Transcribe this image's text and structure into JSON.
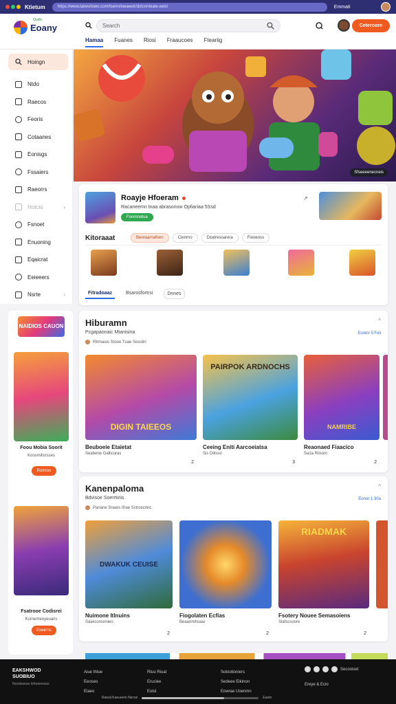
{
  "topbar": {
    "title": "Ktietum",
    "url": "https://www.taiwsrtowo.com/tsenn/ioeaeetr/dstcnnteate.eelsl",
    "user": "Emmati",
    "logo_colors": [
      "#e74c3c",
      "#2ecc71",
      "#f1c40f"
    ]
  },
  "header": {
    "brand": "Eoany",
    "brand_sub": "Quids",
    "search_placeholder": "Search",
    "cta": "Ceteroorn",
    "tabs": [
      "Hamaa",
      "Fuanes",
      "Riosi",
      "Fraaucoes",
      "Fteariig"
    ]
  },
  "sidebar": {
    "home": "Hoingn",
    "items": [
      {
        "label": "Ntdo",
        "icon": "note-icon"
      },
      {
        "label": "Raecos",
        "icon": "bookmark-icon"
      },
      {
        "label": "Feoris",
        "icon": "flag-icon"
      },
      {
        "label": "Cotaanes",
        "icon": "grid-icon"
      },
      {
        "label": "Eonisgs",
        "icon": "puzzle-icon"
      },
      {
        "label": "Fssaiers",
        "icon": "trophy-icon"
      },
      {
        "label": "Raeorrs",
        "icon": "search-icon"
      },
      {
        "label": "Hotcio",
        "icon": "clock-icon",
        "muted": true,
        "chevron": true
      },
      {
        "label": "Fsnoet",
        "icon": "doc-icon"
      },
      {
        "label": "Enuoning",
        "icon": "gamepad-icon"
      },
      {
        "label": "Eqaicrat",
        "icon": "chat-icon"
      },
      {
        "label": "Eeieeers",
        "icon": "star-icon"
      },
      {
        "label": "Nsrte",
        "icon": "pin-icon",
        "chevron": true
      }
    ]
  },
  "hero": {
    "badge": "Sfseeeenecneis"
  },
  "feature": {
    "title": "Roayje Hfoeram",
    "desc": "Racaneemn tnaa abrasoriow Opfiariaa 5Ssd",
    "tag": "Fooronatua",
    "sub_title": "Kitoraaat",
    "chips": [
      "Beoraarnafoen",
      "Cienrno",
      "Dzatresoarera",
      "Fiooeoss"
    ],
    "tabs": [
      "Fitradoaaz",
      "Bsarosfortrsi",
      "Dnnes"
    ]
  },
  "left_col": {
    "logo": "NAIDIOS CAUON",
    "cards": [
      {
        "title": "Foou Mobia Soorit",
        "sub": "Koosmilisrsses",
        "button": "Roimoo"
      },
      {
        "title": "Fsatrooe Codisrei",
        "sub": "Kornemeoyeuaris",
        "button": "Eseernc"
      }
    ]
  },
  "sections": [
    {
      "title": "Hiburamn",
      "sub": "Pcgapaonaic Mtanisina",
      "meta": "Rtrmasio Stooe Tuae Sosoiiri",
      "more": "Eoreni 5:Foil",
      "games": [
        {
          "name": "Beuboeie Etaietat",
          "sub": "Seabene Gallicoras",
          "count": "2",
          "art": "DIGIN TAIEEOS"
        },
        {
          "name": "Ceeing Eniti Aarcoeiatsa",
          "sub": "Sis Dilnssl",
          "count": "3",
          "art": "PAIRPOK ARDNOCHS"
        },
        {
          "name": "Reaonaed Fiaacico",
          "sub": "Sa1a Riisorn",
          "count": "2",
          "art": "NAMRIBE"
        }
      ]
    },
    {
      "title": "Kanenpaloma",
      "sub": "Bdvisoe Soerrtiriis",
      "meta": "Pariane Snaws Ifrae Sctrcecnnc",
      "more": "Eoren 1:30a",
      "games": [
        {
          "name": "Nuimone Itlnuins",
          "sub": "Saieiconsnnieo",
          "count": "2",
          "art": "DWAKUK CEUISE"
        },
        {
          "name": "Fiogolaten Ecfias",
          "sub": "Beaanrehsaai",
          "count": "2",
          "art": ""
        },
        {
          "name": "Fsotery Nouee Semasoiens",
          "sub": "Slafscsoore",
          "count": "2",
          "art": "RIADMAK"
        }
      ]
    }
  ],
  "footer": {
    "brand": "EAKSHWOD SUOBIUO",
    "tag": "Nosdsaeue lofoneeesos",
    "cols": [
      [
        "Aiue Ihtue",
        "Eeoseo",
        "Eiaeo"
      ],
      [
        "Rtuu Riuat",
        "Eruciee",
        "Eotsl"
      ],
      [
        "Sotootioniers",
        "Sedeee Eikinon",
        "Eowrae Uoenmn"
      ]
    ],
    "social_label": "Secooiset",
    "extra": "Ereye & Ecio",
    "bottom_left": "Rawal.Kaeueem Nerssi",
    "bottom_right": "Eaetn"
  }
}
